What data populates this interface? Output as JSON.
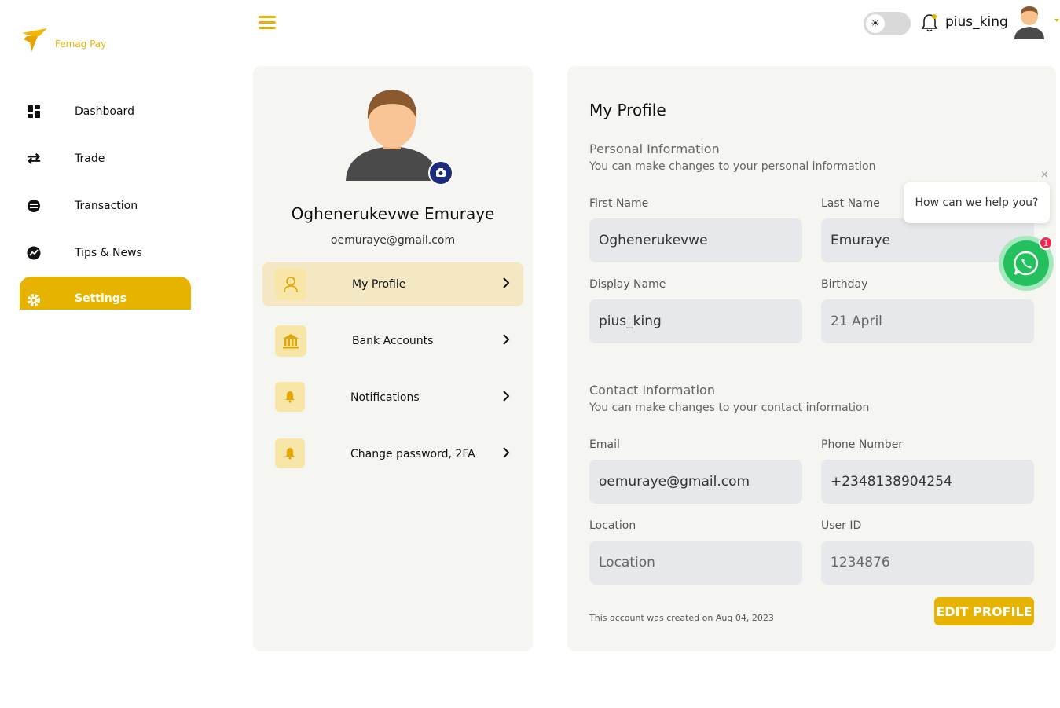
{
  "brand": {
    "name": "Femag Pay",
    "accent": "#e6b400"
  },
  "sidebar": {
    "items": [
      {
        "label": "Dashboard",
        "icon": "dashboard-grid-icon"
      },
      {
        "label": "Trade",
        "icon": "swap-arrows-icon"
      },
      {
        "label": "Transaction",
        "icon": "transaction-icon"
      },
      {
        "label": "Tips & News",
        "icon": "trend-chart-icon"
      },
      {
        "label": "Settings",
        "icon": "gear-icon",
        "active": true
      }
    ]
  },
  "header": {
    "username": "pius_king",
    "theme_icon": "sun-icon",
    "notification_icon": "bell-icon"
  },
  "profile_card": {
    "name": "Oghenerukevwe Emuraye",
    "email": "oemuraye@gmail.com",
    "menu": [
      {
        "label": "My Profile",
        "icon": "user-icon",
        "active": true
      },
      {
        "label": "Bank Accounts",
        "icon": "bank-icon"
      },
      {
        "label": "Notifications",
        "icon": "bell-icon"
      },
      {
        "label": "Change password, 2FA",
        "icon": "bell-icon"
      }
    ]
  },
  "my_profile": {
    "title": "My Profile",
    "personal": {
      "heading": "Personal Information",
      "description": "You can make changes to your personal information",
      "first_name_label": "First Name",
      "first_name_value": "Oghenerukevwe",
      "last_name_label": "Last Name",
      "last_name_value": "Emuraye",
      "display_name_label": "Display Name",
      "display_name_value": "pius_king",
      "birthday_label": "Birthday",
      "birthday_placeholder": "21 April"
    },
    "contact": {
      "heading": "Contact Information",
      "description": "You can make changes to your contact information",
      "email_label": "Email",
      "email_value": "oemuraye@gmail.com",
      "phone_label": "Phone Number",
      "phone_value": "+2348138904254",
      "location_label": "Location",
      "location_placeholder": "Location",
      "user_id_label": "User ID",
      "user_id_placeholder": "1234876"
    },
    "created_note": "This account was created on Aug 04, 2023",
    "edit_button": "EDIT PROFILE"
  },
  "chat_widget": {
    "message": "How can we help you?",
    "close": "×",
    "badge_count": "1",
    "icon": "whatsapp-icon"
  }
}
